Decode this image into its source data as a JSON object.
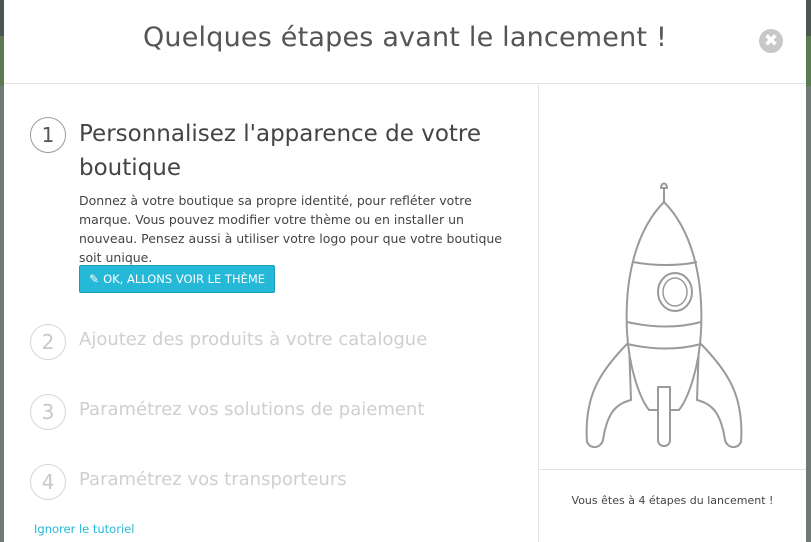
{
  "modal": {
    "title": "Quelques étapes avant le lancement !",
    "close_glyph": "✖"
  },
  "steps": [
    {
      "number": "1",
      "title": "Personnalisez l'apparence de votre boutique",
      "description": "Donnez à votre boutique sa propre identité, pour refléter votre marque. Vous pouvez modifier votre thème ou en installer un nouveau. Pensez aussi à utiliser votre logo pour que votre boutique soit unique.",
      "button_label": "OK, ALLONS VOIR LE THÈME",
      "active": true
    },
    {
      "number": "2",
      "title": "Ajoutez des produits à votre catalogue",
      "active": false
    },
    {
      "number": "3",
      "title": "Paramétrez vos solutions de paiement",
      "active": false
    },
    {
      "number": "4",
      "title": "Paramétrez vos transporteurs",
      "active": false
    }
  ],
  "sidebar": {
    "steps_remaining": "Vous êtes à 4 étapes du lancement !",
    "illustration_icon": "rocket-icon"
  },
  "footer": {
    "skip_label": "Ignorer le tutoriel"
  },
  "colors": {
    "accent": "#25b9d7",
    "title_text": "#555555",
    "muted_step": "#cfcfcf"
  }
}
